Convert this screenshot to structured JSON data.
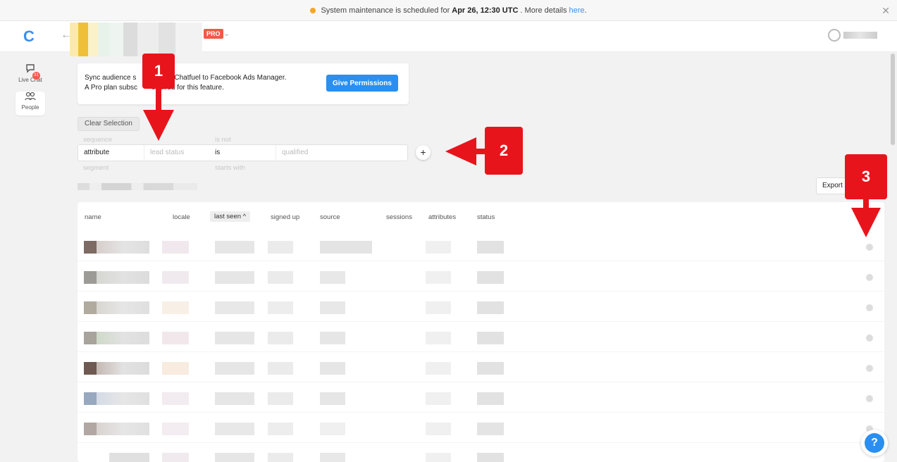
{
  "banner": {
    "text_before": "System maintenance is scheduled for",
    "date_bold": "Apr 26, 12:30 UTC",
    "text_after": ". More details",
    "link": "here",
    "period": "."
  },
  "header": {
    "logo": "C",
    "back_icon": "arrow-left-icon",
    "pro_badge": "PRO"
  },
  "sidebar": {
    "items": [
      {
        "label": "Live Chat",
        "icon": "chat-bubble-icon",
        "badge": "31"
      },
      {
        "label": "People",
        "icon": "people-icon"
      }
    ]
  },
  "sync_card": {
    "line1": "Sync audience s",
    "line1_b": "rom Chatfuel to Facebook Ads Manager.",
    "line2": "A Pro plan subsc",
    "line2_b": "equired for this feature.",
    "button": "Give Permissions"
  },
  "filters": {
    "clear_label": "Clear Selection",
    "suggest_top": {
      "type": "sequence",
      "op": "is not"
    },
    "row": {
      "type": "attribute",
      "name_placeholder": "lead status",
      "op": "is",
      "value_placeholder": "qualified"
    },
    "suggest_bottom": {
      "type": "segment",
      "op": "starts with"
    },
    "add_label": "+"
  },
  "export": {
    "label": "Export"
  },
  "table": {
    "columns": [
      "name",
      "locale",
      "last seen ^",
      "signed up",
      "source",
      "sessions",
      "attributes",
      "status"
    ]
  },
  "callouts": {
    "one": "1",
    "two": "2",
    "three": "3"
  },
  "help": "?",
  "colors": {
    "accent": "#2a8ff0",
    "pro": "#f05a47",
    "callout": "#e8141c"
  }
}
